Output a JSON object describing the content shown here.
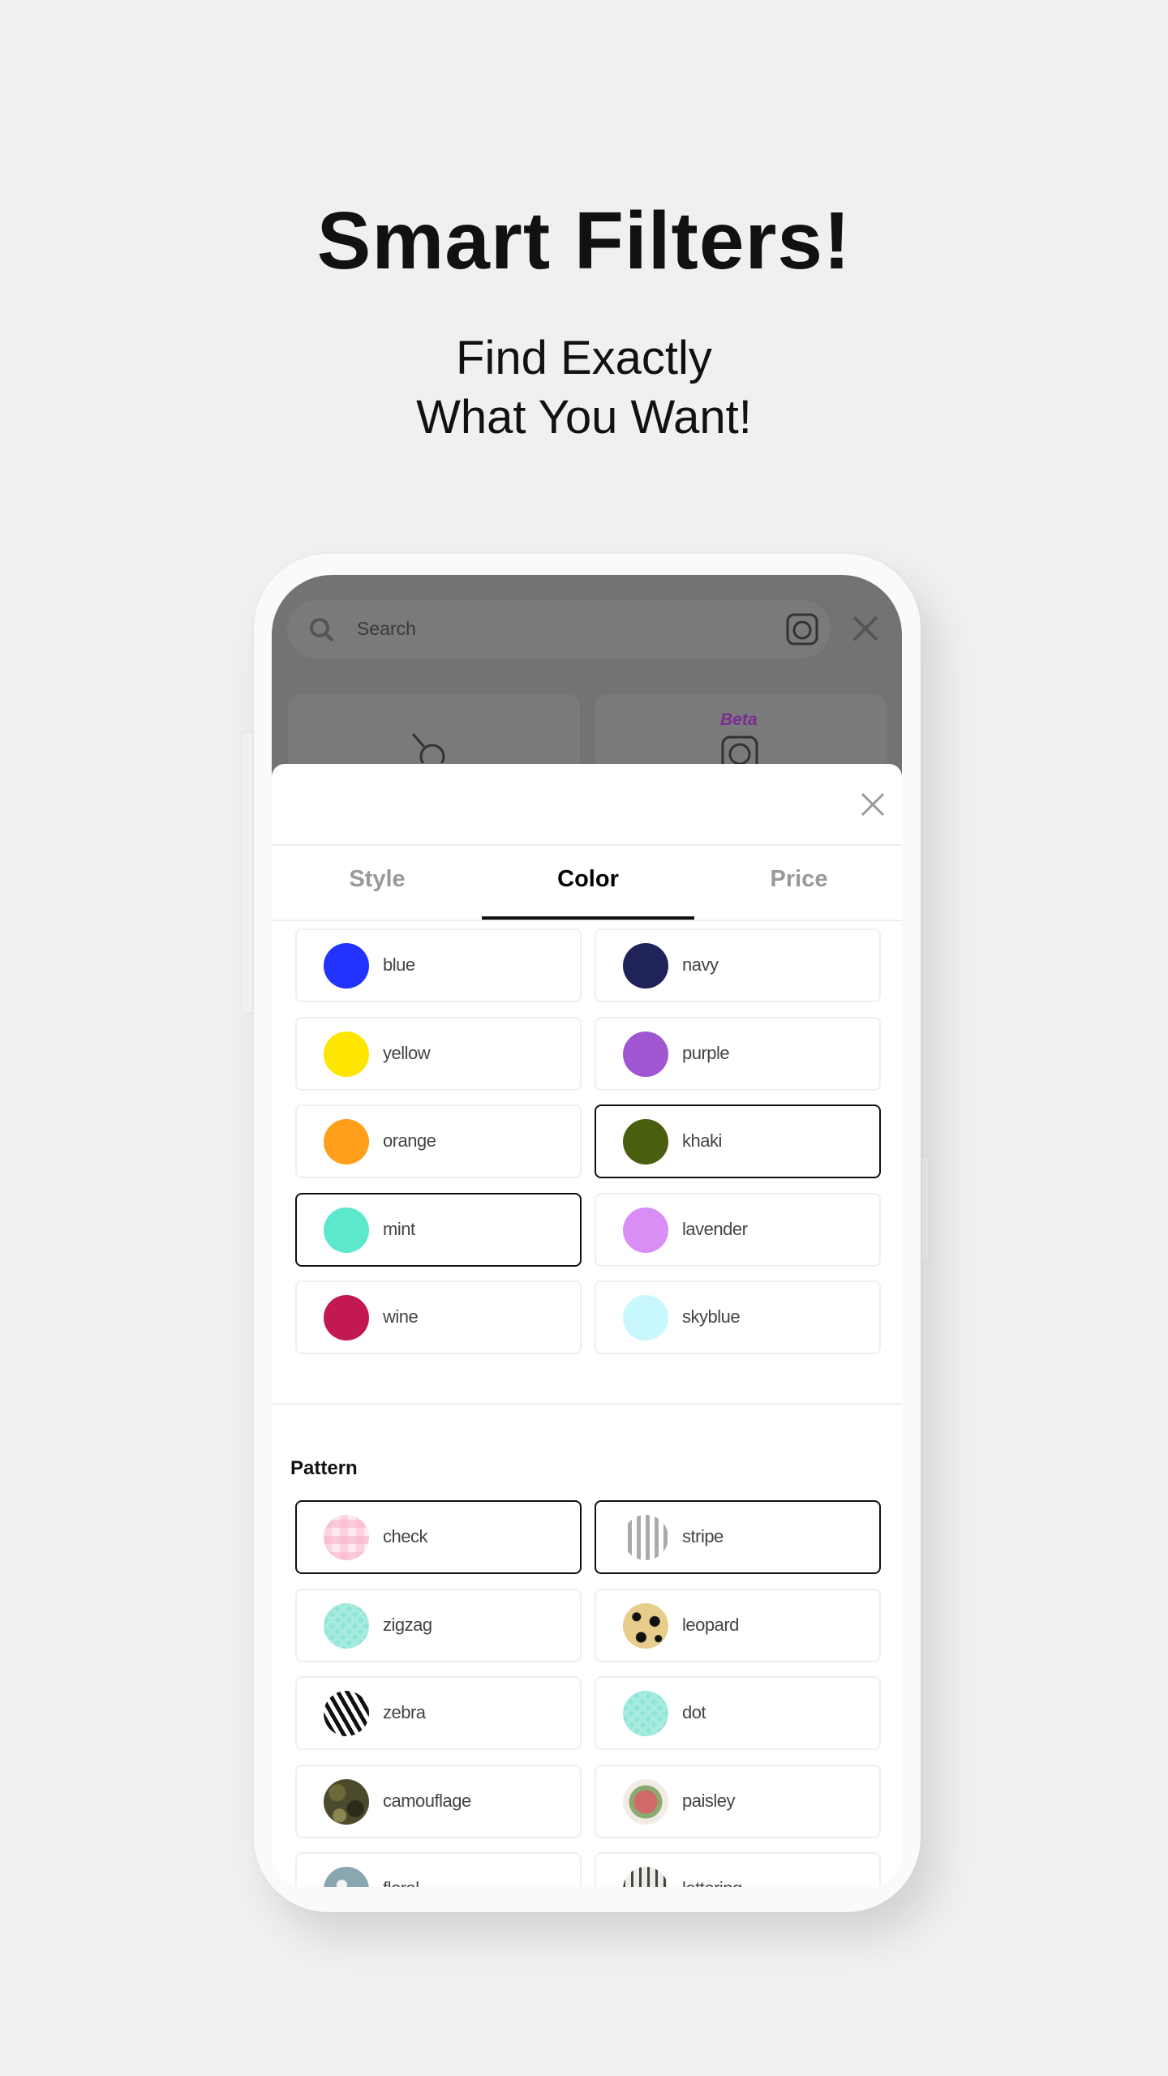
{
  "promo": {
    "title": "Smart Filters!",
    "subtitle_line1": "Find Exactly",
    "subtitle_line2": "What You Want!"
  },
  "background_screen": {
    "search_placeholder": "Search",
    "beta_label": "Beta"
  },
  "sheet": {
    "tabs": [
      {
        "label": "Style",
        "active": false
      },
      {
        "label": "Color",
        "active": true
      },
      {
        "label": "Price",
        "active": false
      }
    ],
    "colors": [
      {
        "label": "blue",
        "color": "#2233ff",
        "selected": false
      },
      {
        "label": "navy",
        "color": "#20225a",
        "selected": false
      },
      {
        "label": "yellow",
        "color": "#ffe600",
        "selected": false
      },
      {
        "label": "purple",
        "color": "#a056d0",
        "selected": false
      },
      {
        "label": "orange",
        "color": "#ff9f1c",
        "selected": false
      },
      {
        "label": "khaki",
        "color": "#4a5e10",
        "selected": true
      },
      {
        "label": "mint",
        "color": "#5ce8cc",
        "selected": true
      },
      {
        "label": "lavender",
        "color": "#d98ef5",
        "selected": false
      },
      {
        "label": "wine",
        "color": "#c21a50",
        "selected": false
      },
      {
        "label": "skyblue",
        "color": "#c8f7fd",
        "selected": false
      }
    ],
    "pattern_title": "Pattern",
    "patterns": [
      {
        "label": "check",
        "icon": "check-pattern",
        "selected": true
      },
      {
        "label": "stripe",
        "icon": "stripe-pattern",
        "selected": true
      },
      {
        "label": "zigzag",
        "icon": "zigzag-pattern",
        "selected": false
      },
      {
        "label": "leopard",
        "icon": "leopard-pattern",
        "selected": false
      },
      {
        "label": "zebra",
        "icon": "zebra-pattern",
        "selected": false
      },
      {
        "label": "dot",
        "icon": "zigzag-pattern",
        "selected": false
      },
      {
        "label": "camouflage",
        "icon": "camouflage-pattern",
        "selected": false
      },
      {
        "label": "paisley",
        "icon": "rose-pattern",
        "selected": false
      },
      {
        "label": "floral",
        "icon": "floral-pattern",
        "selected": false
      },
      {
        "label": "lettering",
        "icon": "lettering-pattern",
        "selected": false
      }
    ]
  }
}
